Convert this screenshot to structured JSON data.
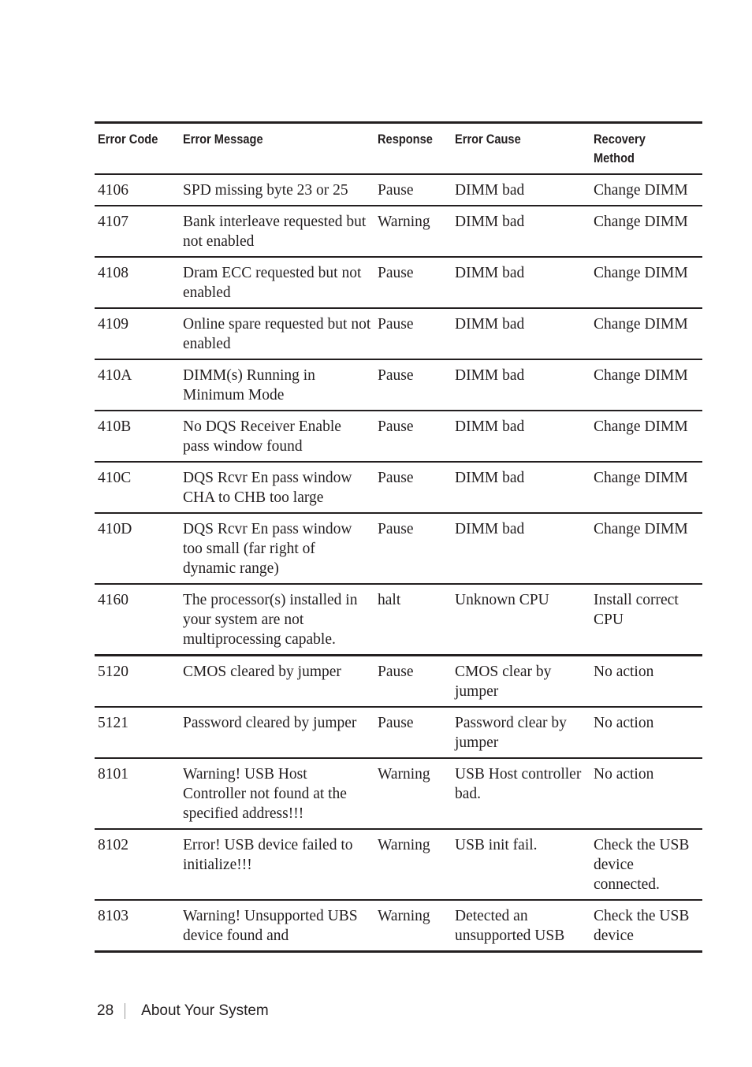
{
  "table": {
    "headers": [
      "Error Code",
      "Error Message",
      "Response",
      "Error Cause",
      "Recovery Method"
    ],
    "rows": [
      {
        "code": "4106",
        "message": "SPD missing byte 23 or 25",
        "response": "Pause",
        "cause": "DIMM bad",
        "recovery": "Change DIMM"
      },
      {
        "code": "4107",
        "message": "Bank interleave requested but not enabled",
        "response": "Warning",
        "cause": "DIMM bad",
        "recovery": "Change DIMM"
      },
      {
        "code": "4108",
        "message": "Dram ECC requested but not enabled",
        "response": "Pause",
        "cause": "DIMM bad",
        "recovery": "Change DIMM"
      },
      {
        "code": "4109",
        "message": "Online spare requested but not enabled",
        "response": "Pause",
        "cause": "DIMM bad",
        "recovery": "Change DIMM"
      },
      {
        "code": "410A",
        "message": "DIMM(s) Running in Minimum Mode",
        "response": "Pause",
        "cause": "DIMM bad",
        "recovery": "Change DIMM"
      },
      {
        "code": "410B",
        "message": "No DQS Receiver Enable pass window found",
        "response": "Pause",
        "cause": "DIMM bad",
        "recovery": "Change DIMM"
      },
      {
        "code": "410C",
        "message": "DQS Rcvr En pass window CHA to CHB too large",
        "response": "Pause",
        "cause": "DIMM bad",
        "recovery": "Change DIMM"
      },
      {
        "code": "410D",
        "message": "DQS Rcvr En pass window too small (far right of dynamic range)",
        "response": "Pause",
        "cause": "DIMM bad",
        "recovery": "Change DIMM"
      },
      {
        "code": "4160",
        "message": "The processor(s) installed in your system are not multiprocessing capable.",
        "response": "halt",
        "cause": "Unknown CPU",
        "recovery": "Install correct CPU"
      },
      {
        "code": "5120",
        "message": "CMOS cleared by jumper",
        "response": "Pause",
        "cause": "CMOS clear by jumper",
        "recovery": "No action"
      },
      {
        "code": "5121",
        "message": "Password cleared by jumper",
        "response": "Pause",
        "cause": "Password clear by jumper",
        "recovery": "No action"
      },
      {
        "code": "8101",
        "message": "Warning! USB Host Controller not found at the specified address!!!",
        "response": "Warning",
        "cause": "USB Host controller bad.",
        "recovery": "No action"
      },
      {
        "code": "8102",
        "message": "Error! USB device failed to initialize!!!",
        "response": "Warning",
        "cause": "USB init fail.",
        "recovery": "Check the USB device connected."
      },
      {
        "code": "8103",
        "message": "Warning! Unsupported UBS device found and",
        "response": "Warning",
        "cause": "Detected an unsupported USB",
        "recovery": "Check the USB device"
      }
    ]
  },
  "footer": {
    "page_number": "28",
    "section_title": "About Your System"
  }
}
